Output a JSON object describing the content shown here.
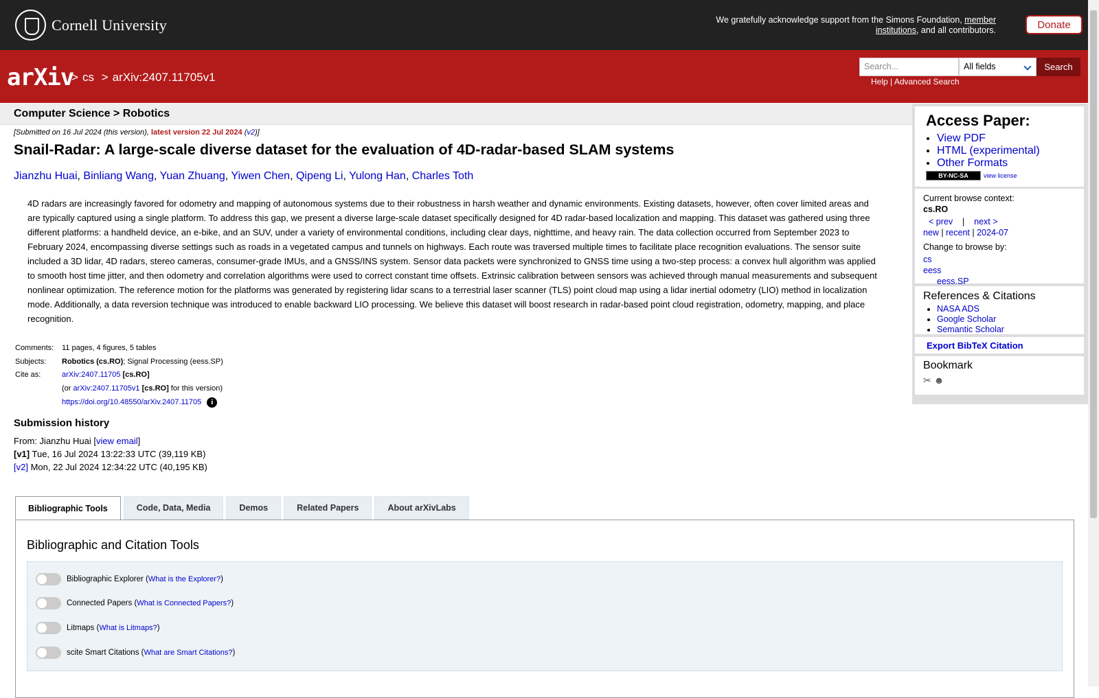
{
  "header": {
    "cornell_name": "Cornell University",
    "ack_text_1": "We gratefully acknowledge support from the Simons Foundation,",
    "ack_link": "member institutions",
    "ack_text_2": ", and all contributors.",
    "donate_label": "Donate"
  },
  "arxiv_bar": {
    "logo_text": "arXiv",
    "breadcrumb": [
      ">",
      "cs",
      ">",
      "arXiv:2407.11705v1"
    ],
    "search_placeholder": "Search...",
    "search_field": "All fields",
    "search_button": "Search",
    "help_link": "Help",
    "separator": "|",
    "advanced_link": "Advanced Search"
  },
  "paper": {
    "subject_header": "Computer Science > Robotics",
    "submitted_prefix": "[Submitted on 16 Jul 2024 (this version), ",
    "latest_version": "latest version 22 Jul 2024",
    "submitted_v2": "v2",
    "title": "Snail-Radar: A large-scale diverse dataset for the evaluation of 4D-radar-based SLAM systems",
    "authors": [
      "Jianzhu Huai",
      "Binliang Wang",
      "Yuan Zhuang",
      "Yiwen Chen",
      "Qipeng Li",
      "Yulong Han",
      "Charles Toth"
    ],
    "abstract": "4D radars are increasingly favored for odometry and mapping of autonomous systems due to their robustness in harsh weather and dynamic environments. Existing datasets, however, often cover limited areas and are typically captured using a single platform. To address this gap, we present a diverse large-scale dataset specifically designed for 4D radar-based localization and mapping. This dataset was gathered using three different platforms: a handheld device, an e-bike, and an SUV, under a variety of environmental conditions, including clear days, nighttime, and heavy rain. The data collection occurred from September 2023 to February 2024, encompassing diverse settings such as roads in a vegetated campus and tunnels on highways. Each route was traversed multiple times to facilitate place recognition evaluations. The sensor suite included a 3D lidar, 4D radars, stereo cameras, consumer-grade IMUs, and a GNSS/INS system. Sensor data packets were synchronized to GNSS time using a two-step process: a convex hull algorithm was applied to smooth host time jitter, and then odometry and correlation algorithms were used to correct constant time offsets. Extrinsic calibration between sensors was achieved through manual measurements and subsequent nonlinear optimization. The reference motion for the platforms was generated by registering lidar scans to a terrestrial laser scanner (TLS) point cloud map using a lidar inertial odometry (LIO) method in localization mode. Additionally, a data reversion technique was introduced to enable backward LIO processing. We believe this dataset will boost research in radar-based point cloud registration, odometry, mapping, and place recognition.",
    "comments_label": "Comments:",
    "comments": "11 pages, 4 figures, 5 tables",
    "subjects_label": "Subjects:",
    "subjects_main": "Robotics (cs.RO)",
    "subjects_rest": "; Signal Processing (eess.SP)",
    "cite_label": "Cite as:",
    "cite_id": "arXiv:2407.11705",
    "cite_tag": "[cs.RO]",
    "cite_or": "(or ",
    "cite_v1": "arXiv:2407.11705v1",
    "cite_v1_tag": "[cs.RO]",
    "cite_v1_suffix": " for this version)",
    "doi": "https://doi.org/10.48550/arXiv.2407.11705"
  },
  "history": {
    "title": "Submission history",
    "from": "From: Jianzhu Huai [",
    "view_email": "view email",
    "v1_label": "[v1]",
    "v1_text": " Tue, 16 Jul 2024 13:22:33 UTC (39,119 KB)",
    "v2_label": "[v2]",
    "v2_text": " Mon, 22 Jul 2024 12:34:22 UTC (40,195 KB)"
  },
  "tabs": [
    "Bibliographic Tools",
    "Code, Data, Media",
    "Demos",
    "Related Papers",
    "About arXivLabs"
  ],
  "tools": {
    "title": "Bibliographic and Citation Tools",
    "items": [
      {
        "label": "Bibliographic Explorer",
        "link": "What is the Explorer?"
      },
      {
        "label": "Connected Papers",
        "link": "What is Connected Papers?"
      },
      {
        "label": "Litmaps",
        "link": "What is Litmaps?"
      },
      {
        "label": "scite Smart Citations",
        "link": "What are Smart Citations?"
      }
    ]
  },
  "sidebar": {
    "access_title": "Access Paper:",
    "access_links": [
      "View PDF",
      "HTML (experimental)",
      "Other Formats"
    ],
    "license_badge": "BY-NC-SA",
    "view_license": "view license",
    "browse_context_label": "Current browse context:",
    "browse_context": "cs.RO",
    "prev": "< prev",
    "sep": "|",
    "next": "next >",
    "new": "new",
    "recent": "recent",
    "month": "2024-07",
    "change_label": "Change to browse by:",
    "browse_cs": "cs",
    "browse_eess": "eess",
    "browse_eess_sp": "eess.SP",
    "refs_title": "References & Citations",
    "refs": [
      "NASA ADS",
      "Google Scholar",
      "Semantic Scholar"
    ],
    "bibtex": "Export BibTeX Citation",
    "bookmark_title": "Bookmark"
  },
  "colors": {
    "arxiv_red": "#b31b1b",
    "cornell_bar": "#222222",
    "link": "#0000cc"
  }
}
